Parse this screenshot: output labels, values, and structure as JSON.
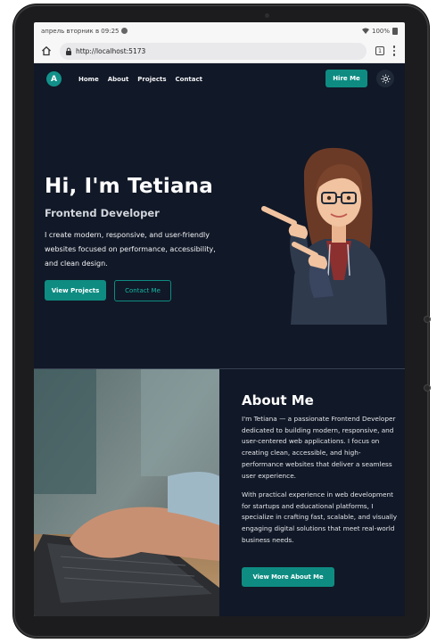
{
  "status_bar": {
    "date_time": "апрель вторник в 09:25",
    "battery_percent": "100%"
  },
  "browser": {
    "url": "http://localhost:5173",
    "tab_count": "1",
    "icons": [
      "home-icon",
      "lock-icon",
      "tabs-icon",
      "more-menu-icon"
    ]
  },
  "nav": {
    "logo_text": "A",
    "links": [
      "Home",
      "About",
      "Projects",
      "Contact"
    ],
    "hire_label": "Hire Me",
    "theme_icon": "sun-icon"
  },
  "hero": {
    "title": "Hi, I'm Tetiana",
    "subtitle": "Frontend Developer",
    "text": "I create modern, responsive, and user-friendly websites focused on performance, accessibility, and clean design.",
    "primary_button": "View Projects",
    "secondary_button": "Contact Me"
  },
  "about": {
    "title": "About Me",
    "paragraph_1": "I'm Tetiana — a passionate Frontend Developer dedicated to building modern, responsive, and user-centered web applications. I focus on creating clean, accessible, and high-performance websites that deliver a seamless user experience.",
    "paragraph_2": "With practical experience in web development for startups and educational platforms, I specialize in crafting fast, scalable, and visually engaging digital solutions that meet real-world business needs.",
    "button": "View More About Me"
  },
  "colors": {
    "background": "#111827",
    "accent": "#0e8c82",
    "text": "#ffffff"
  }
}
